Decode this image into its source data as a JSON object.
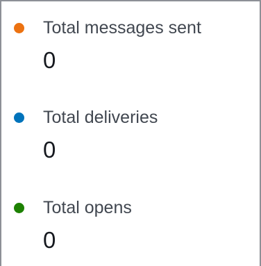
{
  "metrics": [
    {
      "label": "Total messages sent",
      "value": "0",
      "dot_color": "#ec7211"
    },
    {
      "label": "Total deliveries",
      "value": "0",
      "dot_color": "#0073bb"
    },
    {
      "label": "Total opens",
      "value": "0",
      "dot_color": "#1d8102"
    }
  ]
}
